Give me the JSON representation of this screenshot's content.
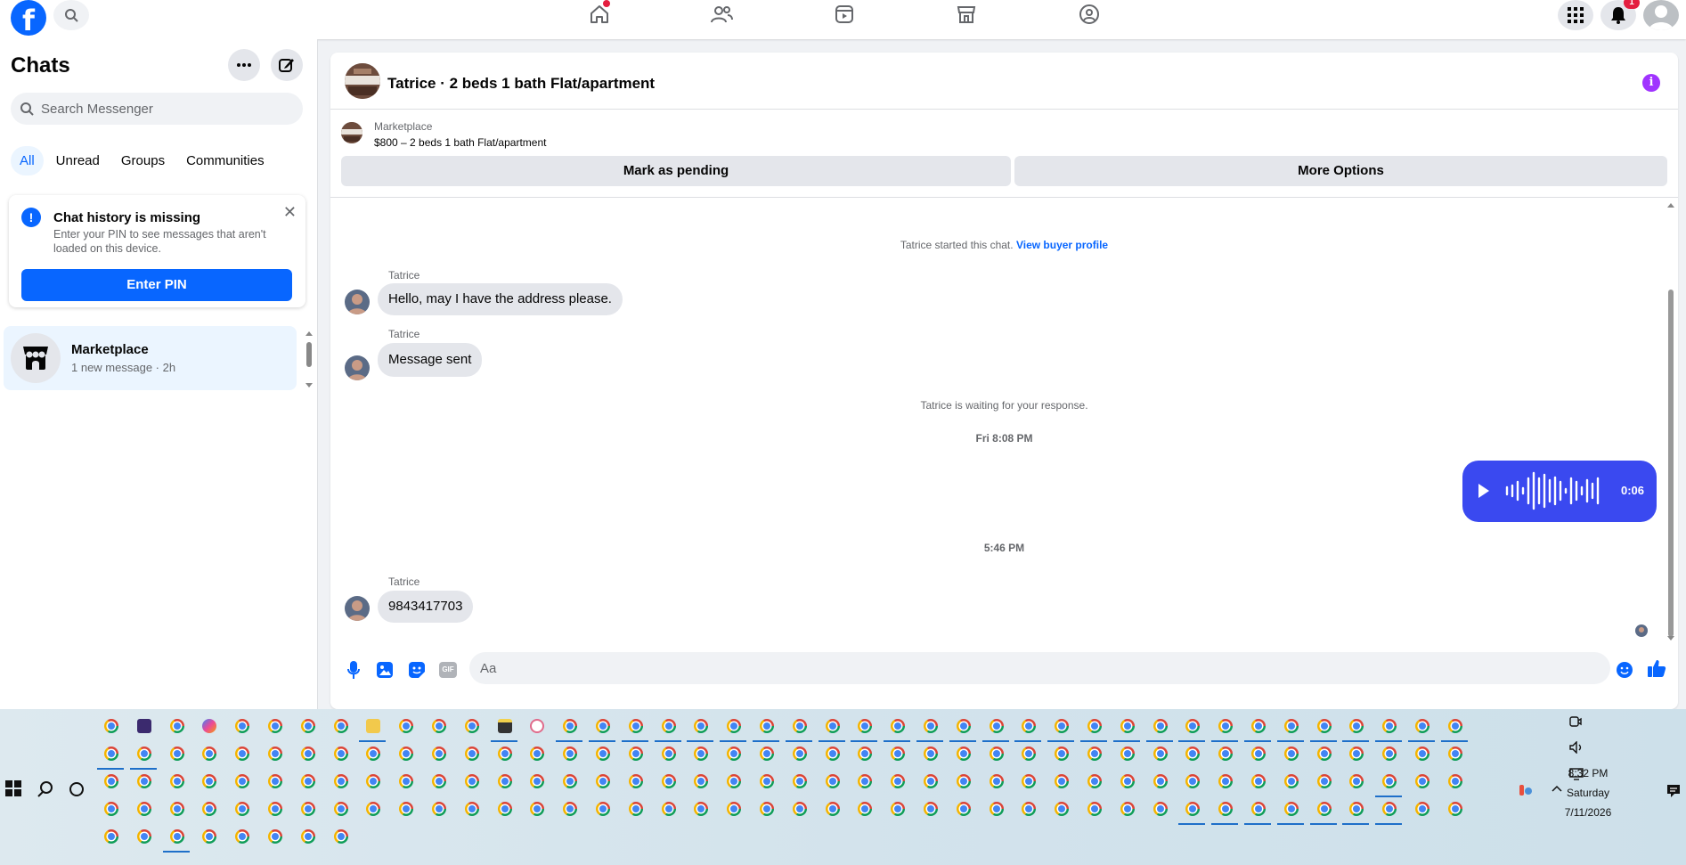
{
  "nav": {
    "logo": "f",
    "notification_badge": "1"
  },
  "sidebar": {
    "title": "Chats",
    "search_placeholder": "Search Messenger",
    "filters": [
      "All",
      "Unread",
      "Groups",
      "Communities"
    ],
    "warning": {
      "title": "Chat history is missing",
      "body": "Enter your PIN to see messages that aren't loaded on this device.",
      "button": "Enter PIN"
    },
    "chats": [
      {
        "name": "Marketplace",
        "subtitle": "1 new message · 2h"
      }
    ]
  },
  "chat": {
    "title": "Tatrice · 2 beds 1 bath Flat/apartment",
    "marketplace": {
      "label": "Marketplace",
      "listing": "$800 – 2 beds 1 bath Flat/apartment",
      "mark_pending": "Mark as pending",
      "more_options": "More Options"
    },
    "started_text": "Tatrice started this chat.",
    "view_profile": "View buyer profile",
    "messages": [
      {
        "sender": "Tatrice",
        "text": "Hello, may I have the address please."
      },
      {
        "sender": "Tatrice",
        "text": "Message sent"
      },
      {
        "sender": "Tatrice",
        "text": "9843417703"
      }
    ],
    "waiting_text": "Tatrice is waiting for your response.",
    "timestamps": [
      "Fri 8:08 PM",
      "5:46 PM"
    ],
    "voice_duration": "0:06",
    "composer_placeholder": "Aa",
    "composer_gif": "GIF"
  },
  "taskbar": {
    "time": "8:32 PM",
    "day": "Saturday",
    "date": "7/11/2026"
  },
  "colors": {
    "brand": "#0866ff",
    "voice_bubble": "#3a49f0",
    "info_icon": "#a033ff"
  }
}
